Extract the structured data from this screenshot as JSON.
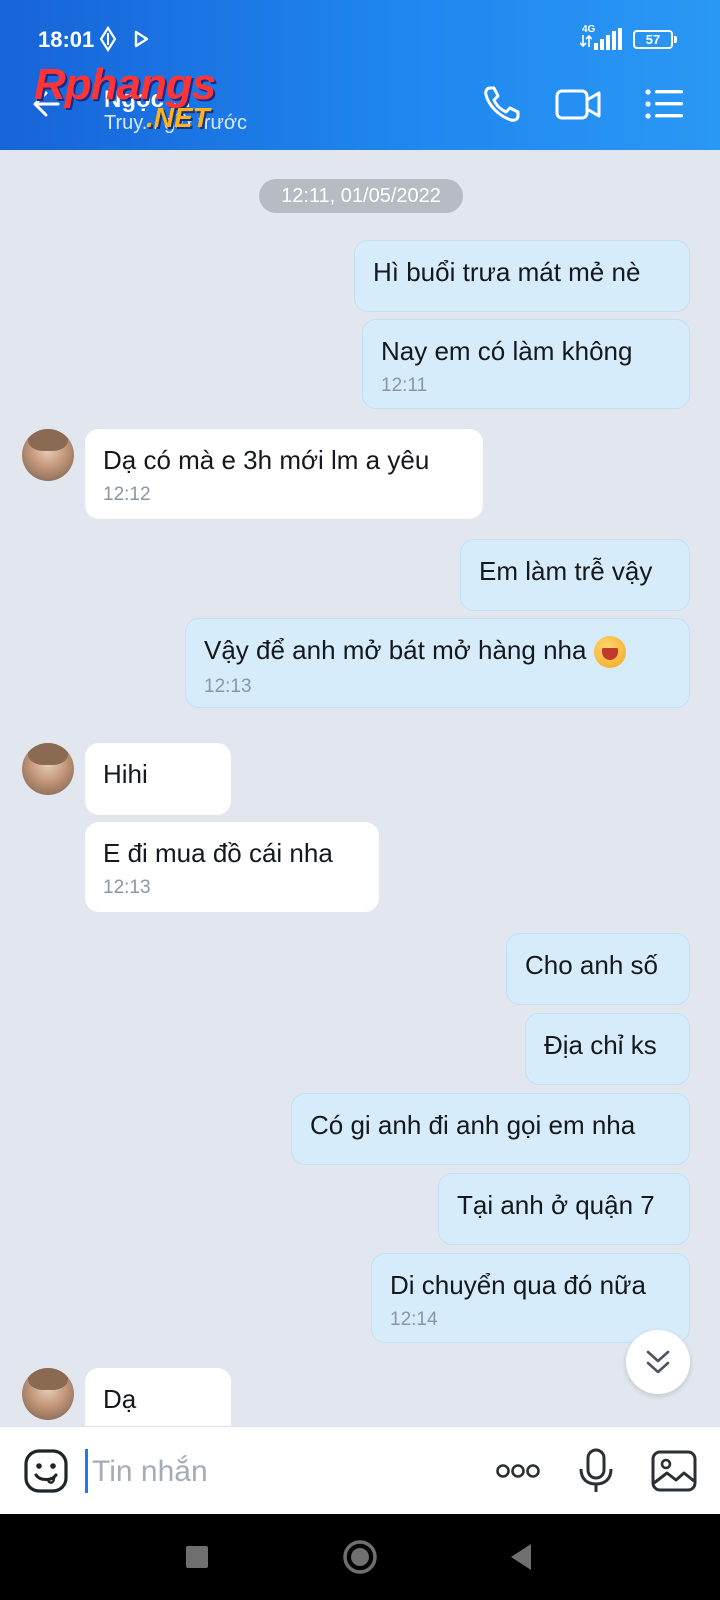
{
  "status_bar": {
    "time": "18:01",
    "network": "4G",
    "battery": "57"
  },
  "header": {
    "contact_name": "Ngọc ...",
    "last_seen": "Truy... giờ trước",
    "watermark_line1": "Rphangs",
    "watermark_line2": ".NET",
    "icons": [
      "back-arrow-icon",
      "phone-icon",
      "video-call-icon",
      "menu-list-icon"
    ]
  },
  "chat": {
    "date_separator": "12:11, 01/05/2022",
    "messages": [
      {
        "side": "me",
        "text": "Hì buổi trưa mát mẻ nè",
        "time": ""
      },
      {
        "side": "me",
        "text": "Nay em có làm không",
        "time": "12:11"
      },
      {
        "side": "them",
        "text": "Dạ có mà e 3h mới lm a yêu",
        "time": "12:12"
      },
      {
        "side": "me",
        "text": "Em làm trễ vậy",
        "time": ""
      },
      {
        "side": "me",
        "text": "Vậy để anh mở bát mở hàng nha",
        "time": "12:13"
      },
      {
        "side": "them",
        "text": "Hihi",
        "time": ""
      },
      {
        "side": "them",
        "text": "E đi mua đồ cái nha",
        "time": "12:13"
      },
      {
        "side": "me",
        "text": "Cho anh số",
        "time": ""
      },
      {
        "side": "me",
        "text": "Địa chỉ ks",
        "time": ""
      },
      {
        "side": "me",
        "text": "Có gi anh đi anh gọi em nha",
        "time": ""
      },
      {
        "side": "me",
        "text": "Tại anh ở quận 7",
        "time": ""
      },
      {
        "side": "me",
        "text": "Di chuyển qua đó nữa",
        "time": "12:14"
      },
      {
        "side": "them",
        "text": "Dạ",
        "time": ""
      }
    ]
  },
  "input_bar": {
    "placeholder": "Tin nhắn",
    "icons": [
      "sticker-icon",
      "more-options-icon",
      "microphone-icon",
      "image-icon"
    ]
  },
  "nav_bar": {
    "icons": [
      "recent-apps-icon",
      "home-icon",
      "back-icon"
    ]
  },
  "colors": {
    "header_gradient_start": "#1764d8",
    "header_gradient_end": "#2a98f5",
    "my_bubble": "#d6ecfb",
    "their_bubble": "#ffffff",
    "chat_background": "#e2e7ef"
  }
}
